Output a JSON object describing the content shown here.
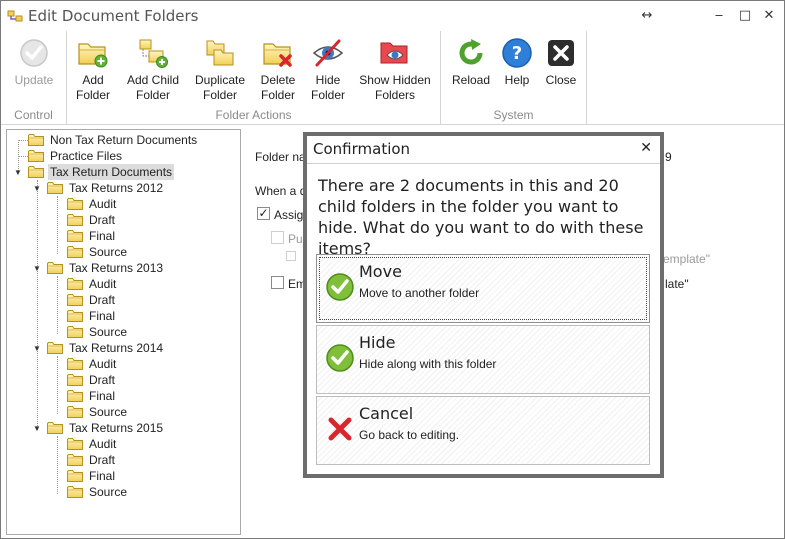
{
  "window": {
    "title": "Edit Document Folders"
  },
  "ribbon": {
    "groups": [
      {
        "label": "Control",
        "buttons": [
          {
            "label": "Update"
          }
        ]
      },
      {
        "label": "Folder Actions",
        "buttons": [
          {
            "label": "Add\nFolder"
          },
          {
            "label": "Add Child\nFolder"
          },
          {
            "label": "Duplicate\nFolder"
          },
          {
            "label": "Delete\nFolder"
          },
          {
            "label": "Hide\nFolder"
          },
          {
            "label": "Show Hidden\nFolders"
          }
        ]
      },
      {
        "label": "System",
        "buttons": [
          {
            "label": "Reload"
          },
          {
            "label": "Help"
          },
          {
            "label": "Close"
          }
        ]
      }
    ]
  },
  "tree": {
    "items": [
      {
        "label": "Non Tax Return Documents"
      },
      {
        "label": "Practice Files"
      },
      {
        "label": "Tax Return Documents"
      },
      {
        "label": "Tax Returns 2012"
      },
      {
        "label": "Audit"
      },
      {
        "label": "Draft"
      },
      {
        "label": "Final"
      },
      {
        "label": "Source"
      },
      {
        "label": "Tax Returns 2013"
      },
      {
        "label": "Audit"
      },
      {
        "label": "Draft"
      },
      {
        "label": "Final"
      },
      {
        "label": "Source"
      },
      {
        "label": "Tax Returns 2014"
      },
      {
        "label": "Audit"
      },
      {
        "label": "Draft"
      },
      {
        "label": "Final"
      },
      {
        "label": "Source"
      },
      {
        "label": "Tax Returns 2015"
      },
      {
        "label": "Audit"
      },
      {
        "label": "Draft"
      },
      {
        "label": "Final"
      },
      {
        "label": "Source"
      }
    ]
  },
  "form": {
    "folder_name_label": "Folder nar",
    "folder_name_tail": "9",
    "when_label": "When a d",
    "assign_label": "Assign",
    "pub_label": "Pu",
    "template_tail": "emplate\"",
    "em_label": "Em",
    "late_tail": "late\""
  },
  "dialog": {
    "title": "Confirmation",
    "close_glyph": "✕",
    "message": "There are 2 documents in this and 20 child folders in the folder you want to hide. What do you want to do with these items?",
    "options": [
      {
        "title": "Move",
        "description": "Move to another folder"
      },
      {
        "title": "Hide",
        "description": "Hide along with this folder"
      },
      {
        "title": "Cancel",
        "description": "Go back to editing."
      }
    ]
  }
}
